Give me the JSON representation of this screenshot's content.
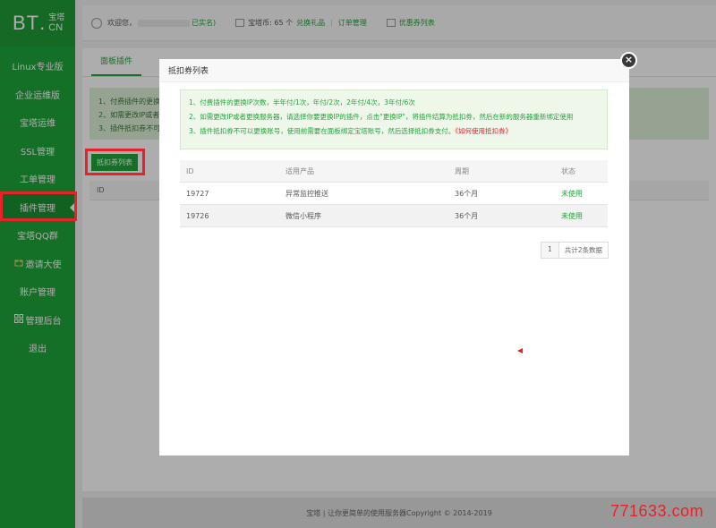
{
  "logo": {
    "bt": "BT",
    "dot": ".",
    "cn_name": "宝塔",
    "cn": "CN"
  },
  "sidebar": {
    "items": [
      {
        "label": "Linux专业版",
        "icon": ""
      },
      {
        "label": "企业运维版",
        "icon": ""
      },
      {
        "label": "宝塔运维",
        "icon": ""
      },
      {
        "label": "SSL管理",
        "icon": ""
      },
      {
        "label": "工单管理",
        "icon": ""
      },
      {
        "label": "插件管理",
        "icon": "",
        "active": true
      },
      {
        "label": "宝塔QQ群",
        "icon": ""
      },
      {
        "label": "邀请大使",
        "icon": "gift-icon"
      },
      {
        "label": "账户管理",
        "icon": ""
      },
      {
        "label": "管理后台",
        "icon": "grid-icon"
      },
      {
        "label": "退出",
        "icon": ""
      }
    ]
  },
  "header": {
    "welcome": "欢迎您，",
    "realname_tag": "已实名)",
    "coins_label": "宝塔币: 65 个",
    "exchange_gift": "兑换礼品",
    "order_mgmt": "订单管理",
    "coupon_list": "优惠券列表",
    "separator": "|"
  },
  "content": {
    "tab": "面板插件",
    "tips": [
      "1、付费插件的更换IP",
      "2、如需更改IP或者更换",
      "3、插件抵扣券不可以"
    ],
    "coupon_button": "抵扣券列表",
    "col_id": "ID"
  },
  "modal": {
    "title": "抵扣券列表",
    "close": "×",
    "notice": [
      "1、付费插件的更换IP次数，半年付/1次，年付/2次，2年付/4次，3年付/6次",
      "2、如需更改IP或者更换服务器，请选择你要更换IP的插件，点击\"更换IP\"，将插件结算为抵扣券，然后在新的服务器重新绑定使用",
      "3、插件抵扣券不可以更换账号，使用前需要在面板绑定宝塔账号，然后选择抵扣券支付。"
    ],
    "notice_link": "《如何使用抵扣券》",
    "table": {
      "headers": [
        "ID",
        "适用产品",
        "周期",
        "状态"
      ],
      "rows": [
        [
          "19727",
          "异常监控推送",
          "36个月",
          "未使用"
        ],
        [
          "19726",
          "微信小程序",
          "36个月",
          "未使用"
        ]
      ]
    },
    "pager": {
      "page": "1",
      "total": "共计2条数据"
    }
  },
  "footer": {
    "text": "宝塔 | 让你更简单的使用服务器Copyright © 2014-2019"
  },
  "watermark": "771633.com",
  "colors": {
    "brand_green": "#20a53a",
    "highlight_red": "#e8212b"
  }
}
